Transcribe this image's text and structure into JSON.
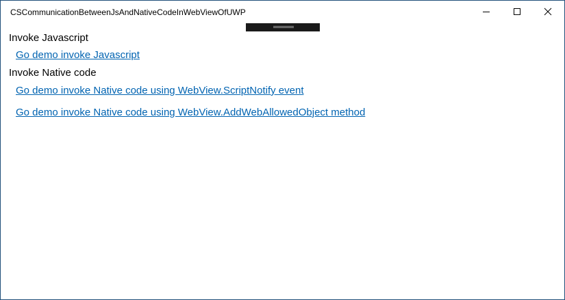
{
  "window": {
    "title": "CSCommunicationBetweenJsAndNativeCodeInWebViewOfUWP"
  },
  "caption_buttons": {
    "minimize_icon": "minimize-icon",
    "maximize_icon": "maximize-icon",
    "close_icon": "close-icon"
  },
  "sections": {
    "javascript": {
      "heading": "Invoke Javascript",
      "links": [
        "Go demo invoke Javascript"
      ]
    },
    "native": {
      "heading": "Invoke Native code",
      "links": [
        "Go demo invoke Native code using WebView.ScriptNotify event",
        "Go demo invoke Native code using WebView.AddWebAllowedObject method"
      ]
    }
  },
  "colors": {
    "link": "#0063b1",
    "window_border": "#1f4e79"
  }
}
